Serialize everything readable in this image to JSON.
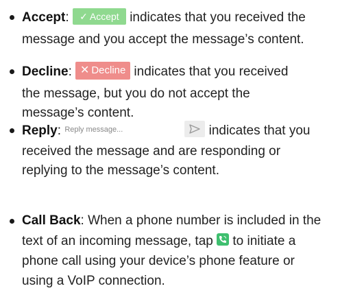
{
  "items": [
    {
      "term": "Accept",
      "sep": ": ",
      "button": {
        "label": "Accept",
        "icon": "check-icon",
        "color": "#8fd98f"
      },
      "line1_rest": " indicates that you received the",
      "line2": "message and you accept the message’s content."
    },
    {
      "term": "Decline",
      "sep": ": ",
      "button": {
        "label": "Decline",
        "icon": "x-icon",
        "color": "#ef8d8b"
      },
      "line1_rest": " indicates that you received",
      "line2": "the message, but you do not accept the",
      "line3": "message’s content."
    },
    {
      "term": "Reply",
      "sep": ":",
      "placeholder": "Reply message...",
      "send_icon": "send-icon",
      "line1_rest": " indicates that you",
      "line2": "received the message and are responding or",
      "line3": "replying to the message’s content."
    },
    {
      "term": "Call Back",
      "line1_rest": ": When a phone number is included in the",
      "line2_pre": "text of an incoming message, tap ",
      "call_icon": "phone-icon",
      "line2_post": " to initiate a",
      "line3": "phone call using your device’s phone feature or",
      "line4": "using a VoIP connection."
    }
  ]
}
